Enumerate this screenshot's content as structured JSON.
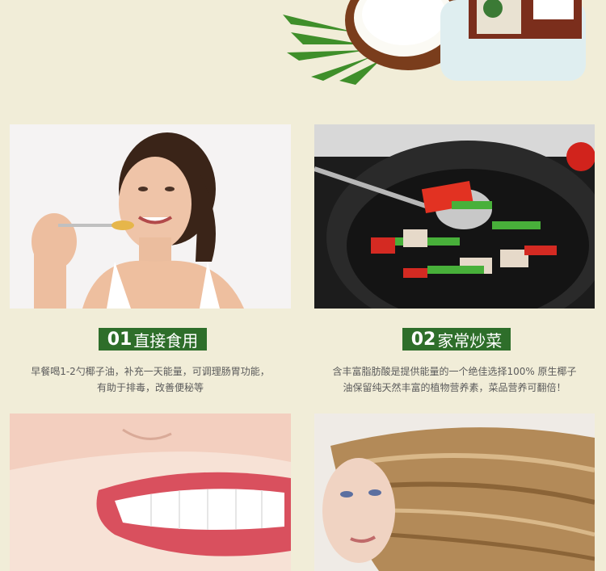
{
  "hero": {
    "brand_badge_icon": "label-badge-icon"
  },
  "sections": [
    {
      "number": "01",
      "label": "直接食用",
      "desc_line1": "早餐喝1-2勺椰子油，补充一天能量，可调理肠胃功能，",
      "desc_line2": "有助于排毒，改善便秘等",
      "photo": "woman-eating-photo"
    },
    {
      "number": "02",
      "label": "家常炒菜",
      "desc_line1": "含丰富脂肪酸是提供能量的一个绝佳选择100% 原生椰子",
      "desc_line2": "油保留纯天然丰富的植物营养素，菜品营养可翻倍！",
      "photo": "wok-stir-fry-photo"
    }
  ],
  "photos_bottom": [
    "smile-teeth-photo",
    "long-hair-woman-photo"
  ],
  "colors": {
    "background": "#f1edd8",
    "tag": "#2e6e2a",
    "text": "#5b5b5b"
  }
}
